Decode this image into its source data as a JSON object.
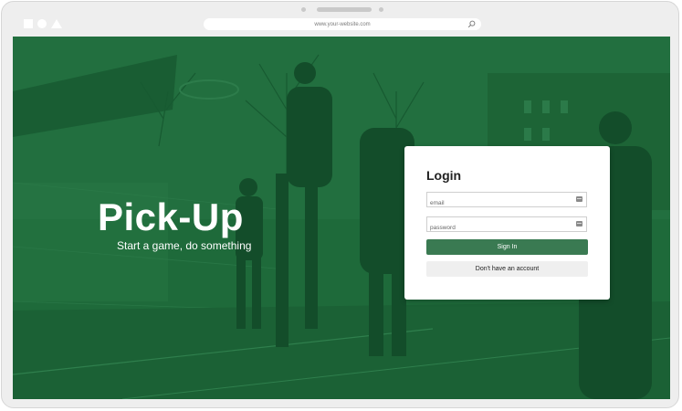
{
  "browser": {
    "url": "www.your-website.com",
    "icons": [
      "square-icon",
      "circle-icon",
      "triangle-icon",
      "search-icon"
    ]
  },
  "hero": {
    "title": "Pick-Up",
    "subtitle": "Start a game, do something"
  },
  "login": {
    "title": "Login",
    "email_placeholder": "email",
    "password_placeholder": "password",
    "sign_in_label": "Sign In",
    "register_label": "Don't have an account"
  },
  "colors": {
    "overlay_green": "#1f6a3b",
    "primary_button": "#3a7a52",
    "secondary_button": "#efefef"
  }
}
